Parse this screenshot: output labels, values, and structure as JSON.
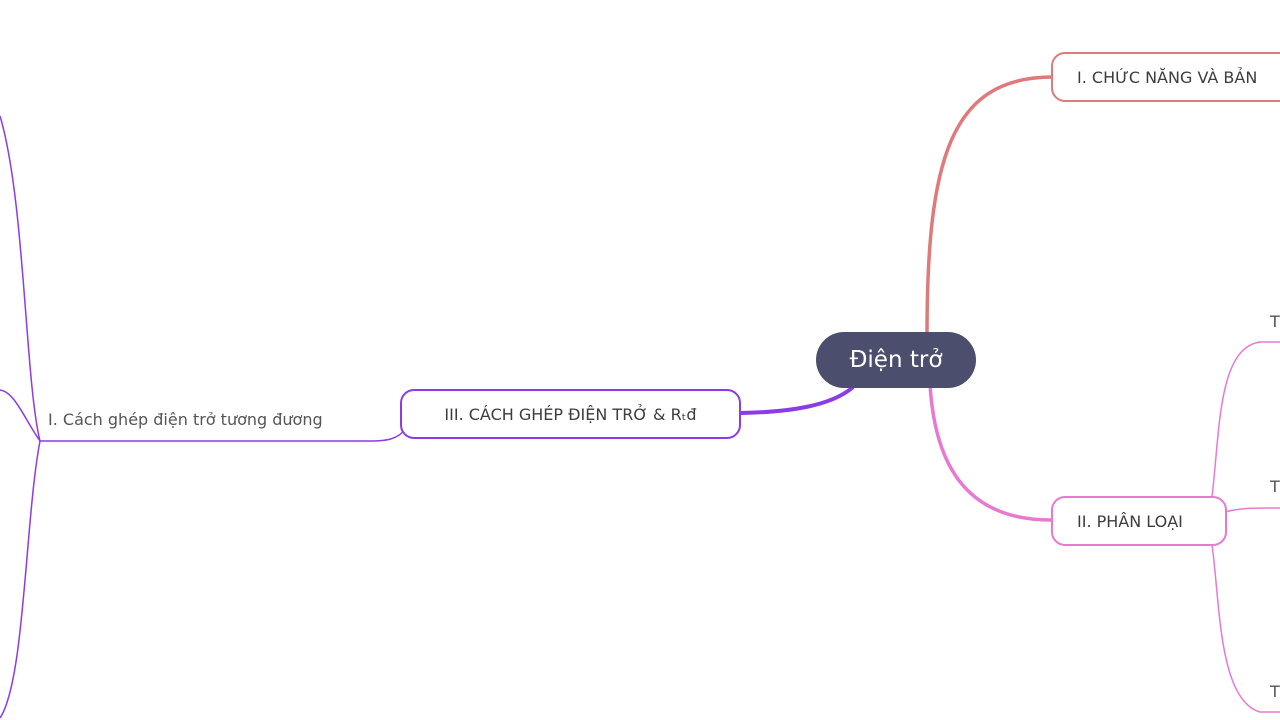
{
  "mindmap": {
    "root": "Điện trở",
    "branches": {
      "functions": {
        "label": "I. CHỨC NĂNG VÀ BẢN",
        "color": "#df7a7a"
      },
      "classification": {
        "label": "II. PHÂN LOẠI",
        "color": "#e77ad0",
        "children": [
          "T",
          "T",
          "T"
        ]
      },
      "connection": {
        "label": "III. CÁCH GHÉP ĐIỆN TRỞ & Rₜđ",
        "color": "#8a3ce6",
        "children": [
          "I. Cách ghép điện trở tương đương"
        ]
      }
    }
  }
}
